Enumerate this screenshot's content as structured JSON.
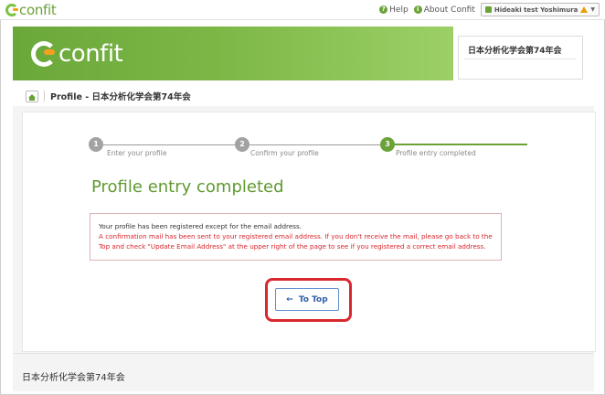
{
  "header": {
    "logo_text": "confit",
    "help_label": "Help",
    "about_label": "About Confit",
    "user_label": "Hideaki test Yoshimura"
  },
  "banner": {
    "logo_text": "confit",
    "conference_name": "日本分析化学会第74年会"
  },
  "breadcrumb": {
    "text": "Profile - 日本分析化学会第74年会"
  },
  "steps": [
    {
      "number": "1",
      "label": "Enter your profile"
    },
    {
      "number": "2",
      "label": "Confirm your profile"
    },
    {
      "number": "3",
      "label": "Profile entry completed"
    }
  ],
  "main": {
    "heading": "Profile entry completed",
    "message_line1": "Your profile has been registered except for the email address.",
    "message_line2": "A confirmation mail has been sent to your registered email address. If you don't receive the mail, please go back to the Top and check \"Update Email Address\" at the upper right of the page to see if you registered a correct email address.",
    "to_top_label": "To Top",
    "to_top_arrow": "←"
  },
  "footer": {
    "text": "日本分析化学会第74年会"
  },
  "colors": {
    "accent_green": "#6aa237",
    "error_red": "#d9272e",
    "link_blue": "#2e5fa8"
  }
}
